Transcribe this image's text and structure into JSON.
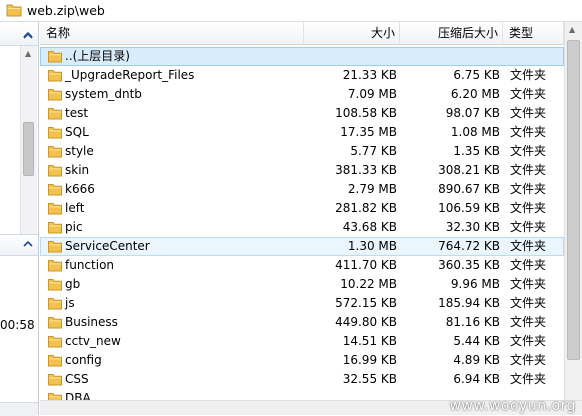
{
  "address": {
    "path": "web.zip\\web",
    "icon": "folder-icon"
  },
  "left_pane": {
    "time_fragment": "00:58"
  },
  "columns": {
    "name": "名称",
    "size": "大小",
    "compressed": "压缩后大小",
    "type": "类型"
  },
  "rows": [
    {
      "name": "..(上层目录)",
      "size": "",
      "compressed": "",
      "type": "",
      "state": "selected"
    },
    {
      "name": "_UpgradeReport_Files",
      "size": "21.33 KB",
      "compressed": "6.75 KB",
      "type": "文件夹"
    },
    {
      "name": "system_dntb",
      "size": "7.09 MB",
      "compressed": "6.20 MB",
      "type": "文件夹"
    },
    {
      "name": "test",
      "size": "108.58 KB",
      "compressed": "98.07 KB",
      "type": "文件夹"
    },
    {
      "name": "SQL",
      "size": "17.35 MB",
      "compressed": "1.08 MB",
      "type": "文件夹"
    },
    {
      "name": "style",
      "size": "5.77 KB",
      "compressed": "1.35 KB",
      "type": "文件夹"
    },
    {
      "name": "skin",
      "size": "381.33 KB",
      "compressed": "308.21 KB",
      "type": "文件夹"
    },
    {
      "name": "k666",
      "size": "2.79 MB",
      "compressed": "890.67 KB",
      "type": "文件夹"
    },
    {
      "name": "left",
      "size": "281.82 KB",
      "compressed": "106.59 KB",
      "type": "文件夹"
    },
    {
      "name": "pic",
      "size": "43.68 KB",
      "compressed": "32.30 KB",
      "type": "文件夹"
    },
    {
      "name": "ServiceCenter",
      "size": "1.30 MB",
      "compressed": "764.72 KB",
      "type": "文件夹",
      "state": "hover"
    },
    {
      "name": "function",
      "size": "411.70 KB",
      "compressed": "360.35 KB",
      "type": "文件夹"
    },
    {
      "name": "gb",
      "size": "10.22 MB",
      "compressed": "9.96 MB",
      "type": "文件夹"
    },
    {
      "name": "js",
      "size": "572.15 KB",
      "compressed": "185.94 KB",
      "type": "文件夹"
    },
    {
      "name": "Business",
      "size": "449.80 KB",
      "compressed": "81.16 KB",
      "type": "文件夹"
    },
    {
      "name": "cctv_new",
      "size": "14.51 KB",
      "compressed": "5.44 KB",
      "type": "文件夹"
    },
    {
      "name": "config",
      "size": "16.99 KB",
      "compressed": "4.89 KB",
      "type": "文件夹"
    },
    {
      "name": "CSS",
      "size": "32.55 KB",
      "compressed": "6.94 KB",
      "type": "文件夹"
    },
    {
      "name": "DBA",
      "size": "",
      "compressed": "",
      "type": ""
    }
  ],
  "watermark": "www.wooyun.org",
  "colors": {
    "folder": "#f2c14e",
    "folder_dark": "#d9a22b",
    "selected_bg": "#d9ecfb",
    "hover_bg": "#eaf5fd"
  }
}
